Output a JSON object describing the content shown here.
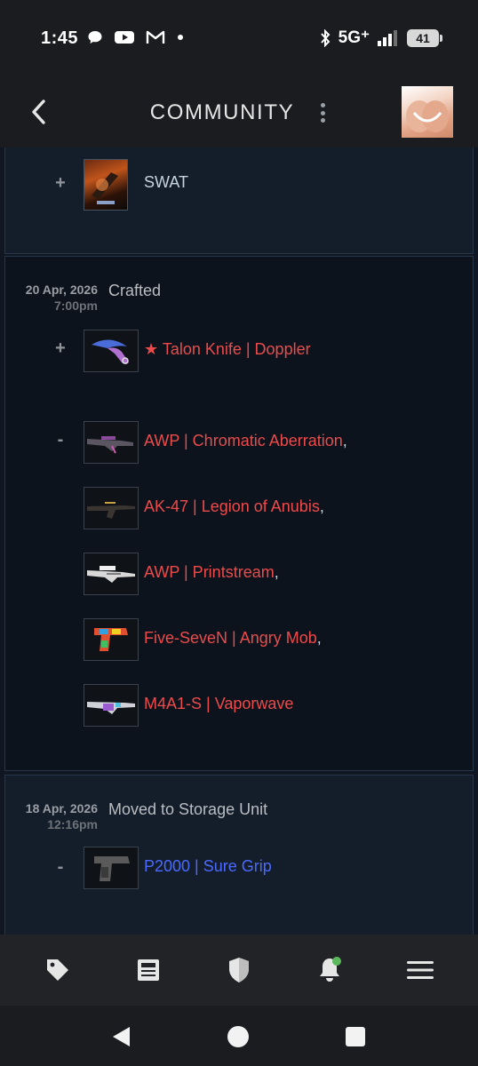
{
  "status_bar": {
    "time": "1:45",
    "network": "5G⁺",
    "battery": "41",
    "icons_left": [
      "chat-bubble-icon",
      "youtube-icon",
      "gmail-icon",
      "dot-icon"
    ],
    "icons_right": [
      "bluetooth-icon",
      "signal-icon",
      "battery-icon"
    ]
  },
  "header": {
    "title": "COMMUNITY",
    "icons": [
      "back-arrow-icon",
      "more-vertical-icon",
      "avatar-image"
    ]
  },
  "entries": [
    {
      "date": "",
      "time": "",
      "action": "",
      "groups": [
        {
          "sign": "+",
          "items": [
            {
              "name": "SWAT",
              "rarity": "plain",
              "comma": ""
            }
          ]
        }
      ]
    },
    {
      "date": "20 Apr, 2026",
      "time": "7:00pm",
      "action": "Crafted",
      "groups": [
        {
          "sign": "+",
          "items": [
            {
              "name": "★ Talon Knife | Doppler",
              "rarity": "red",
              "comma": ""
            }
          ]
        },
        {
          "sign": "-",
          "items": [
            {
              "name": "AWP | Chromatic Aberration",
              "rarity": "red",
              "comma": ","
            },
            {
              "name": "AK-47 | Legion of Anubis",
              "rarity": "red",
              "comma": ","
            },
            {
              "name": "AWP | Printstream",
              "rarity": "red",
              "comma": ","
            },
            {
              "name": "Five-SeveN | Angry Mob",
              "rarity": "red",
              "comma": ","
            },
            {
              "name": "M4A1-S | Vaporwave",
              "rarity": "red",
              "comma": ""
            }
          ]
        }
      ]
    },
    {
      "date": "18 Apr, 2026",
      "time": "12:16pm",
      "action": "Moved to Storage Unit",
      "groups": [
        {
          "sign": "-",
          "items": [
            {
              "name": "P2000 | Sure Grip",
              "rarity": "blue",
              "comma": ""
            }
          ]
        }
      ]
    }
  ],
  "colors": {
    "covert_red": "#eb4b4b",
    "mil_spec_blue": "#4b69ff",
    "background": "#101722",
    "notification_dot": "#5cb85c"
  },
  "bottom_nav": [
    "tag-icon",
    "news-icon",
    "shield-icon",
    "notifications-bell-icon",
    "hamburger-menu-icon"
  ],
  "android_nav": [
    "back-triangle-icon",
    "home-circle-icon",
    "recents-square-icon"
  ]
}
